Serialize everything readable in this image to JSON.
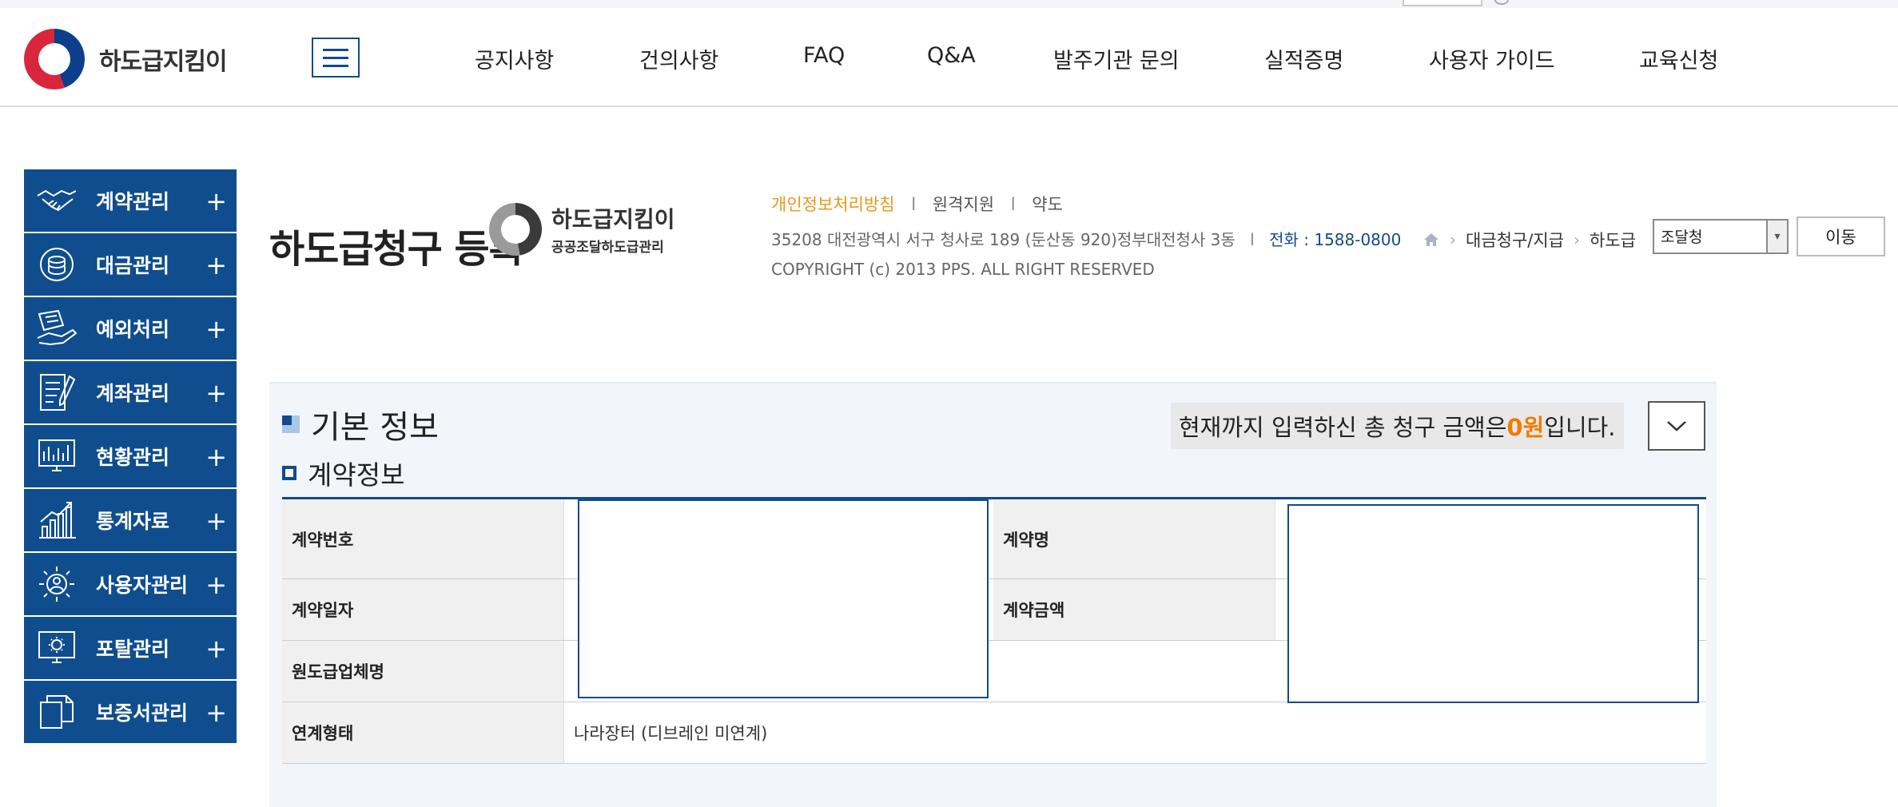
{
  "header": {
    "logo_text": "하도급지킴이",
    "nav": [
      "공지사항",
      "건의사항",
      "FAQ",
      "Q&A",
      "발주기관 문의",
      "실적증명",
      "사용자 가이드",
      "교육신청"
    ]
  },
  "sidebar": {
    "items": [
      {
        "label": "계약관리",
        "icon": "handshake-icon"
      },
      {
        "label": "대금관리",
        "icon": "coins-icon"
      },
      {
        "label": "예외처리",
        "icon": "hand-document-icon"
      },
      {
        "label": "계좌관리",
        "icon": "document-pen-icon"
      },
      {
        "label": "현황관리",
        "icon": "monitor-chart-icon"
      },
      {
        "label": "통계자료",
        "icon": "growth-chart-icon"
      },
      {
        "label": "사용자관리",
        "icon": "user-gear-icon"
      },
      {
        "label": "포탈관리",
        "icon": "monitor-gear-icon"
      },
      {
        "label": "보증서관리",
        "icon": "documents-icon"
      }
    ],
    "plus": "+"
  },
  "page": {
    "title": "하도급청구 등록"
  },
  "popup_logo": {
    "line1": "하도급지킴이",
    "line2": "공공조달하도급관리"
  },
  "footer_info": {
    "links": [
      "개인정보처리방침",
      "원격지원",
      "약도"
    ],
    "sep": "l",
    "address": "35208 대전광역시 서구 청사로 189 (둔산동 920)정부대전청사 3동",
    "tel": "전화 : 1588-0800",
    "copyright": "COPYRIGHT (c) 2013 PPS. ALL RIGHT RESERVED"
  },
  "breadcrumb": {
    "items": [
      "대금청구/지급",
      "하도급"
    ]
  },
  "org_select": {
    "value": "조달청"
  },
  "go_button": "이동",
  "section": {
    "title": "기본 정보",
    "subtitle": "계약정보",
    "total_prefix": "현재까지 입력하신 총 청구 금액은 ",
    "total_amount": "0원",
    "total_suffix": "입니다."
  },
  "table": {
    "contract_no": "계약번호",
    "contract_name": "계약명",
    "contract_date": "계약일자",
    "contract_amount": "계약금액",
    "prime_contractor": "원도급업체명",
    "link_type_label": "연계형태",
    "link_type_value": "나라장터 (디브레인 미연계)"
  },
  "colors": {
    "primary": "#0f4d8f",
    "accent_orange": "#f07c00",
    "link_yellow": "#e8961b"
  }
}
